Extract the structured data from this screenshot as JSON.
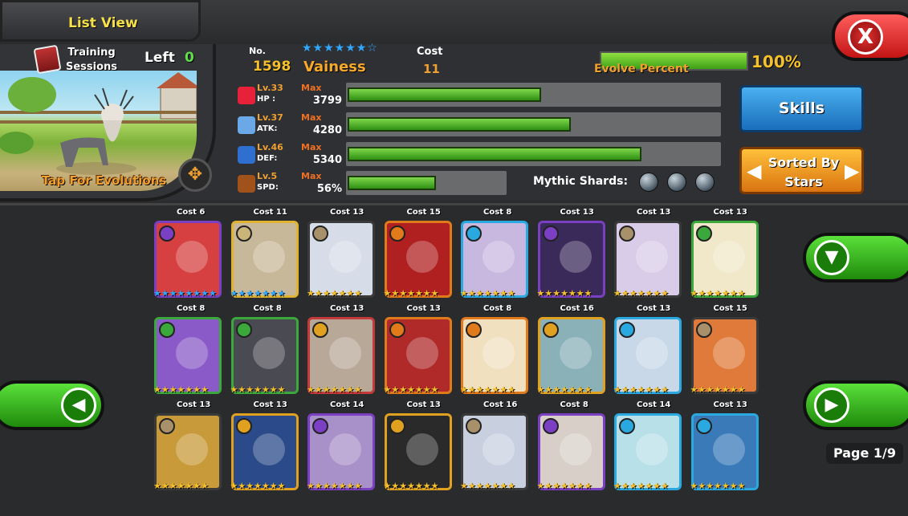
{
  "header": {
    "list_view_label": "List View",
    "close_glyph": "X"
  },
  "training": {
    "label_line1": "Training",
    "label_line2": "Sessions",
    "left_label": "Left",
    "left_value": "0"
  },
  "portrait": {
    "tap_evolutions": "Tap For Evolutions",
    "evo_icon_glyph": "✥"
  },
  "monster": {
    "no_label": "No.",
    "no_value": "1598",
    "name": "Vainess",
    "stars": "★★★★★★☆",
    "cost_label": "Cost",
    "cost_value": "11",
    "evolve_label": "Evolve Percent",
    "evolve_percent": "100%",
    "evolve_fraction": 1.0
  },
  "stats": [
    {
      "key": "hp",
      "level": "Lv.33",
      "name": "HP :",
      "max": "Max",
      "value": "3799",
      "fill": 0.52,
      "bar_len": 0.52,
      "icon": "heart-icon",
      "color": "#e8213a"
    },
    {
      "key": "atk",
      "level": "Lv.37",
      "name": "ATK:",
      "max": "Max",
      "value": "4280",
      "fill": 0.6,
      "icon": "sword-icon",
      "color": "#6aa8e8"
    },
    {
      "key": "def",
      "level": "Lv.46",
      "name": "DEF:",
      "max": "Max",
      "value": "5340",
      "fill": 0.79,
      "icon": "shield-icon",
      "color": "#2f6fd0"
    },
    {
      "key": "spd",
      "level": "Lv.5",
      "name": "SPD:",
      "max": "Max",
      "value": "56%",
      "fill": 0.56,
      "icon": "boot-icon",
      "color": "#a0521a"
    }
  ],
  "buttons": {
    "skills": "Skills",
    "sorted_line1": "Sorted By",
    "sorted_line2": "Stars",
    "arrow_left": "◀",
    "arrow_right": "▶"
  },
  "mythic": {
    "label": "Mythic Shards:",
    "count": 3
  },
  "cards": [
    {
      "cost": "Cost 6",
      "stars": "★★★★★★★★",
      "star_color": "#2fa8ff",
      "elem": "#7b3fc4",
      "bg": "#d64040",
      "border": "#7b3fc4"
    },
    {
      "cost": "Cost 11",
      "stars": "★★★★★★★",
      "star_color": "#2fa8ff",
      "elem": "#c9b47a",
      "bg": "#c8b89a",
      "border": "#e0b430"
    },
    {
      "cost": "Cost 13",
      "stars": "★★★★★★★",
      "star_color": "#f5c02a",
      "elem": "#a8906a",
      "bg": "#d7dde8",
      "border": "#3a3a3a"
    },
    {
      "cost": "Cost 15",
      "stars": "★★★★★★★",
      "star_color": "#f5c02a",
      "elem": "#e07a1a",
      "bg": "#b02020",
      "border": "#e07a1a"
    },
    {
      "cost": "Cost 8",
      "stars": "★★★★★★★",
      "star_color": "#f5c02a",
      "elem": "#2aa8e0",
      "bg": "#c8b8e0",
      "border": "#2aa8e0"
    },
    {
      "cost": "Cost 13",
      "stars": "★★★★★★★",
      "star_color": "#f5c02a",
      "elem": "#7b3fc4",
      "bg": "#3a2a5a",
      "border": "#7b3fc4"
    },
    {
      "cost": "Cost 13",
      "stars": "★★★★★★★",
      "star_color": "#f5c02a",
      "elem": "#a8906a",
      "bg": "#d8cce8",
      "border": "#3a3a3a"
    },
    {
      "cost": "Cost 13",
      "stars": "★★★★★★★",
      "star_color": "#f5c02a",
      "elem": "#3aa83a",
      "bg": "#f0e8c8",
      "border": "#3aa83a"
    },
    {
      "cost": "Cost 8",
      "stars": "★★★★★★★",
      "star_color": "#f5c02a",
      "elem": "#3aa83a",
      "bg": "#8a5ac8",
      "border": "#3aa83a"
    },
    {
      "cost": "Cost 8",
      "stars": "★★★★★★★",
      "star_color": "#f5c02a",
      "elem": "#3aa83a",
      "bg": "#4a4a52",
      "border": "#3aa83a"
    },
    {
      "cost": "Cost 13",
      "stars": "★★★★★★★",
      "star_color": "#f5c02a",
      "elem": "#e0a020",
      "bg": "#b8a898",
      "border": "#c43a3a"
    },
    {
      "cost": "Cost 13",
      "stars": "★★★★★★★",
      "star_color": "#f5c02a",
      "elem": "#e07a1a",
      "bg": "#b02a2a",
      "border": "#e07a1a"
    },
    {
      "cost": "Cost 8",
      "stars": "★★★★★★★",
      "star_color": "#f5c02a",
      "elem": "#e07a1a",
      "bg": "#f0e0c0",
      "border": "#e07a1a"
    },
    {
      "cost": "Cost 16",
      "stars": "★★★★★★★",
      "star_color": "#f5c02a",
      "elem": "#e0a020",
      "bg": "#8ab0b8",
      "border": "#e0a020"
    },
    {
      "cost": "Cost 13",
      "stars": "★★★★★★★",
      "star_color": "#f5c02a",
      "elem": "#2aa8e0",
      "bg": "#c8d8e8",
      "border": "#2aa8e0"
    },
    {
      "cost": "Cost 15",
      "stars": "★★★★★★★",
      "star_color": "#f5c02a",
      "elem": "#a8906a",
      "bg": "#e07a3a",
      "border": "#3a3a3a"
    },
    {
      "cost": "Cost 13",
      "stars": "★★★★★★★",
      "star_color": "#f5c02a",
      "elem": "#a8906a",
      "bg": "#c89a3a",
      "border": "#3a3a3a"
    },
    {
      "cost": "Cost 13",
      "stars": "★★★★★★★",
      "star_color": "#f5c02a",
      "elem": "#e0a020",
      "bg": "#2a4a8a",
      "border": "#e0a020"
    },
    {
      "cost": "Cost 14",
      "stars": "★★★★★★★",
      "star_color": "#f5c02a",
      "elem": "#7b3fc4",
      "bg": "#a890c8",
      "border": "#7b3fc4"
    },
    {
      "cost": "Cost 13",
      "stars": "★★★★★★★",
      "star_color": "#f5c02a",
      "elem": "#e0a020",
      "bg": "#2a2a2a",
      "border": "#e0a020"
    },
    {
      "cost": "Cost 16",
      "stars": "★★★★★★★",
      "star_color": "#f5c02a",
      "elem": "#a8906a",
      "bg": "#c8d0e0",
      "border": "#3a3a3a"
    },
    {
      "cost": "Cost 8",
      "stars": "★★★★★★★",
      "star_color": "#f5c02a",
      "elem": "#7b3fc4",
      "bg": "#d8d0c8",
      "border": "#7b3fc4"
    },
    {
      "cost": "Cost 14",
      "stars": "★★★★★★★",
      "star_color": "#f5c02a",
      "elem": "#2aa8e0",
      "bg": "#b8e0e8",
      "border": "#2aa8e0"
    },
    {
      "cost": "Cost 13",
      "stars": "★★★★★★★",
      "star_color": "#f5c02a",
      "elem": "#2aa8e0",
      "bg": "#3a7ab8",
      "border": "#2aa8e0"
    }
  ],
  "nav": {
    "filter_glyph": "▼",
    "prev_glyph": "◀",
    "next_glyph": "▶",
    "page": "Page 1/9"
  }
}
